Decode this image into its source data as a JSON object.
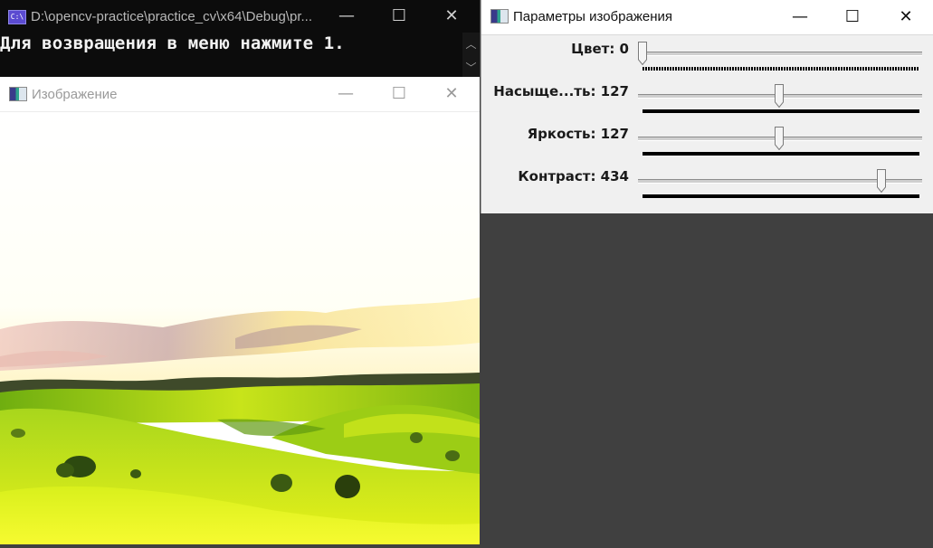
{
  "console": {
    "icon_label": "C:\\",
    "title": "D:\\opencv-practice\\practice_cv\\x64\\Debug\\pr...",
    "output_text": "Для возвращения в меню нажмите 1.",
    "minimize_glyph": "—",
    "maximize_glyph": "☐",
    "close_glyph": "✕",
    "scroll_up_glyph": "︿",
    "scroll_down_glyph": "﹀"
  },
  "image_window": {
    "title": "Изображение",
    "minimize_glyph": "—",
    "maximize_glyph": "☐",
    "close_glyph": "✕",
    "picture_description_icon": "landscape-image"
  },
  "params_window": {
    "title": "Параметры изображения",
    "minimize_glyph": "—",
    "maximize_glyph": "☐",
    "close_glyph": "✕",
    "trackbars": [
      {
        "label": "Цвет: 0",
        "value": 0,
        "max": 179,
        "ticks": "dense"
      },
      {
        "label": "Насыще...ть: 127",
        "value": 127,
        "max": 255,
        "ticks": "solid"
      },
      {
        "label": "Яркость: 127",
        "value": 127,
        "max": 255,
        "ticks": "solid"
      },
      {
        "label": "Контраст: 434",
        "value": 434,
        "max": 500,
        "ticks": "solid"
      }
    ]
  },
  "colors": {
    "desktop_bg": "#404040",
    "console_bg": "#0c0c0c",
    "params_bg": "#f0f0f0"
  }
}
